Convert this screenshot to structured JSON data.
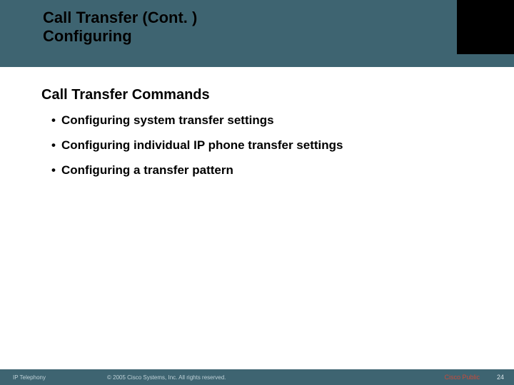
{
  "title": {
    "line1": "Call Transfer (Cont. )",
    "line2": "Configuring"
  },
  "heading": "Call Transfer Commands",
  "bullets": [
    "Configuring system transfer settings",
    "Configuring individual IP phone transfer settings",
    "Configuring a transfer pattern"
  ],
  "footer": {
    "left": "IP Telephony",
    "center": "© 2005 Cisco Systems, Inc. All rights reserved.",
    "public": "Cisco Public",
    "page": "24"
  }
}
